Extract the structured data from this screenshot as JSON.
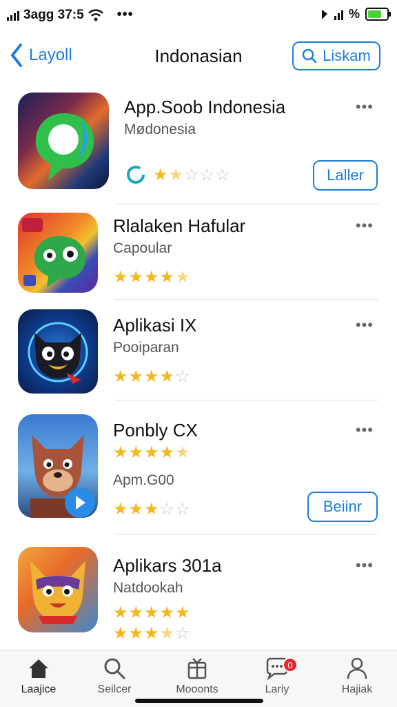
{
  "status": {
    "carrier": "3agg 37:5",
    "battery_fill": 0.85
  },
  "nav": {
    "back_label": "Layoll",
    "title": "Indonasian",
    "search_label": "Liskam"
  },
  "apps": [
    {
      "name": "App.Soob Indonesia",
      "subtitle": "Mødonesia",
      "rating": 1.5,
      "button": "Laller",
      "more": "•••"
    },
    {
      "name": "Rlalaken Hafular",
      "subtitle": "Capoular",
      "rating": 4.5,
      "more": "•••"
    },
    {
      "name": "Aplikasi IX",
      "subtitle": "Pooiparan",
      "rating": 4,
      "more": "•••"
    },
    {
      "name": "Ponbly CX",
      "subtitle": "Apm.G00",
      "rating": 4.5,
      "rating2": 3,
      "button": "Beiinr",
      "more": "•••"
    },
    {
      "name": "Aplikars 301a",
      "subtitle": "Natdookah",
      "rating": 5,
      "rating2": 3.5,
      "more": "•••"
    }
  ],
  "tabs": [
    {
      "label": "Laajice",
      "icon": "home-icon"
    },
    {
      "label": "Seilcer",
      "icon": "search-icon"
    },
    {
      "label": "Mooonts",
      "icon": "gift-icon"
    },
    {
      "label": "Lariy",
      "icon": "chat-icon",
      "badge": "0"
    },
    {
      "label": "Hajiak",
      "icon": "person-icon"
    }
  ]
}
